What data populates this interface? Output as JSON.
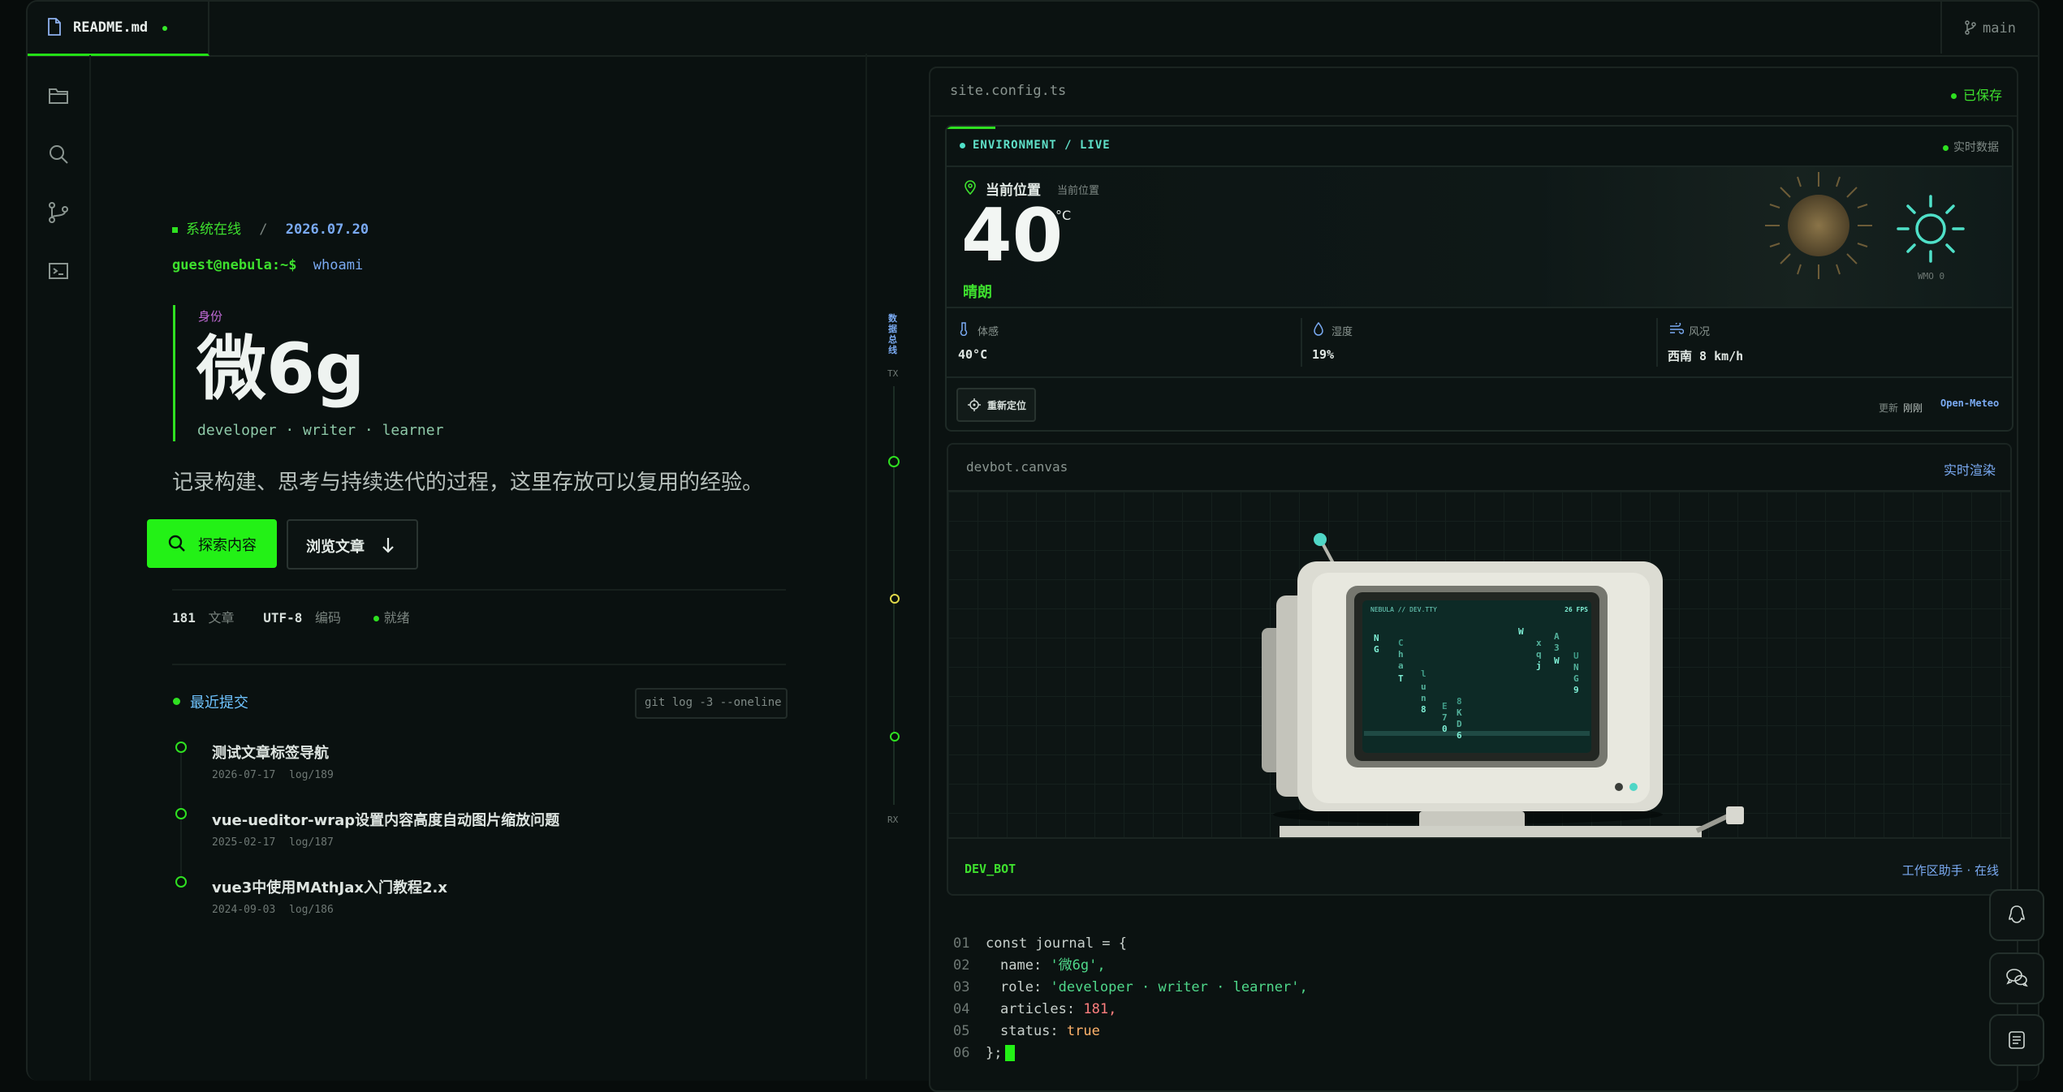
{
  "tab": {
    "filename": "README.md"
  },
  "branch": {
    "name": "main"
  },
  "hero": {
    "status": "系统在线",
    "separator": "/",
    "date": "2026.07.20",
    "prompt": "guest@nebula:~$",
    "command": "whoami",
    "identity_label": "身份",
    "name": "微6g",
    "roles": "developer · writer · learner",
    "tagline": "记录构建、思考与持续迭代的过程，这里存放可以复用的经验。",
    "primary_button": "探索内容",
    "secondary_button": "浏览文章",
    "stats": {
      "articles_count": "181",
      "articles_label": "文章",
      "encoding": "UTF-8",
      "encoding_label": "编码",
      "ready": "就绪"
    }
  },
  "commits": {
    "title": "最近提交",
    "command": "git log -3 --oneline",
    "items": [
      {
        "title": "测试文章标签导航",
        "date": "2026-07-17",
        "ref": "log/189"
      },
      {
        "title": "vue-ueditor-wrap设置内容高度自动图片缩放问题",
        "date": "2025-02-17",
        "ref": "log/187"
      },
      {
        "title": "vue3中使用MAthJax入门教程2.x",
        "date": "2024-09-03",
        "ref": "log/186"
      }
    ]
  },
  "rail": {
    "title": "数据总线",
    "tx": "TX",
    "rx": "RX"
  },
  "editor": {
    "filename": "site.config.ts",
    "status": "已保存"
  },
  "weather": {
    "header": "ENVIRONMENT / LIVE",
    "live": "实时数据",
    "location": "当前位置",
    "location_sub": "当前位置",
    "temperature": "40",
    "unit": "°C",
    "condition": "晴朗",
    "wmo": "WMO 0",
    "metrics": [
      {
        "label": "体感",
        "value": "40°C"
      },
      {
        "label": "湿度",
        "value": "19%"
      },
      {
        "label": "风况",
        "value": "西南 8 km/h"
      }
    ],
    "relocate_button": "重新定位",
    "updated_label": "更新",
    "updated_value": "刚刚",
    "source": "Open-Meteo"
  },
  "devbot": {
    "title": "devbot.canvas",
    "live": "实时渲染",
    "screen_title": "NEBULA // DEV.TTY",
    "fps": "26 FPS",
    "bot_label": "DEV_BOT",
    "bot_status": "工作区助手 · 在线"
  },
  "code": [
    {
      "no": "01",
      "text": "const journal = {"
    },
    {
      "no": "02",
      "key": "name:",
      "value": "'微6g',"
    },
    {
      "no": "03",
      "key": "role:",
      "value": "'developer · writer · learner',"
    },
    {
      "no": "04",
      "key": "articles:",
      "value": "181,"
    },
    {
      "no": "05",
      "key": "status:",
      "value": "true"
    },
    {
      "no": "06",
      "text": "};"
    }
  ],
  "floating": [
    "qq-icon",
    "wechat-icon",
    "notes-icon"
  ],
  "colors": {
    "accent": "#23f116",
    "background": "#070c0b",
    "link": "#7aaaf2",
    "code_string": "#4fd88a",
    "code_number": "#ff7f7f"
  }
}
